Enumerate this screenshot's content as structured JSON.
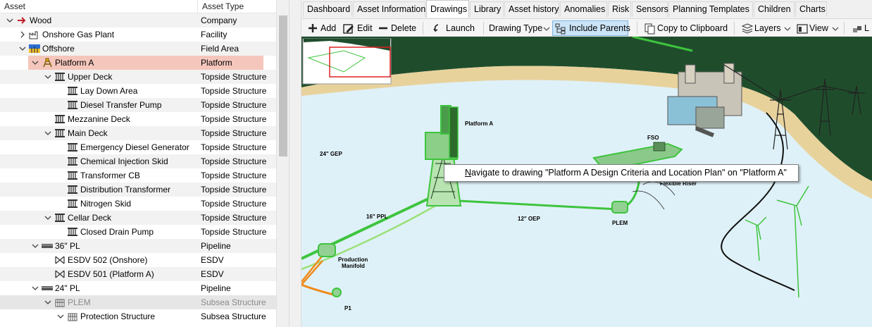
{
  "tree": {
    "col_asset": "Asset",
    "col_type": "Asset Type",
    "rows": [
      {
        "label": "Wood",
        "type": "Company",
        "indent": 0,
        "exp": "v",
        "icon": "arrow"
      },
      {
        "label": "Onshore Gas Plant",
        "type": "Facility",
        "indent": 1,
        "exp": ">",
        "icon": "plant"
      },
      {
        "label": "Offshore",
        "type": "Field Area",
        "indent": 1,
        "exp": "v",
        "icon": "field"
      },
      {
        "label": "Platform A",
        "type": "Platform",
        "indent": 2,
        "exp": "v",
        "icon": "platform"
      },
      {
        "label": "Upper Deck",
        "type": "Topside Structure",
        "indent": 3,
        "exp": "v",
        "icon": "struct"
      },
      {
        "label": "Lay Down Area",
        "type": "Topside Structure",
        "indent": 4,
        "exp": "",
        "icon": "struct"
      },
      {
        "label": "Diesel Transfer Pump",
        "type": "Topside Structure",
        "indent": 4,
        "exp": "",
        "icon": "struct"
      },
      {
        "label": "Mezzanine Deck",
        "type": "Topside Structure",
        "indent": 3,
        "exp": "",
        "icon": "struct"
      },
      {
        "label": "Main Deck",
        "type": "Topside Structure",
        "indent": 3,
        "exp": "v",
        "icon": "struct"
      },
      {
        "label": "Emergency Diesel Generator",
        "type": "Topside Structure",
        "indent": 4,
        "exp": "",
        "icon": "struct"
      },
      {
        "label": "Chemical Injection Skid",
        "type": "Topside Structure",
        "indent": 4,
        "exp": "",
        "icon": "struct"
      },
      {
        "label": "Transformer CB",
        "type": "Topside Structure",
        "indent": 4,
        "exp": "",
        "icon": "struct"
      },
      {
        "label": "Distribution Transformer",
        "type": "Topside Structure",
        "indent": 4,
        "exp": "",
        "icon": "struct"
      },
      {
        "label": "Nitrogen Skid",
        "type": "Topside Structure",
        "indent": 4,
        "exp": "",
        "icon": "struct"
      },
      {
        "label": "Cellar Deck",
        "type": "Topside Structure",
        "indent": 3,
        "exp": "v",
        "icon": "struct"
      },
      {
        "label": "Closed Drain Pump",
        "type": "Topside Structure",
        "indent": 4,
        "exp": "",
        "icon": "struct"
      },
      {
        "label": "36\" PL",
        "type": "Pipeline",
        "indent": 2,
        "exp": "v",
        "icon": "pipe"
      },
      {
        "label": "ESDV 502 (Onshore)",
        "type": "ESDV",
        "indent": 3,
        "exp": "",
        "icon": "valve"
      },
      {
        "label": "ESDV 501 (Platform A)",
        "type": "ESDV",
        "indent": 3,
        "exp": "",
        "icon": "valve"
      },
      {
        "label": "24\" PL",
        "type": "Pipeline",
        "indent": 2,
        "exp": "v",
        "icon": "pipe"
      },
      {
        "label": "PLEM",
        "type": "Subsea Structure",
        "indent": 3,
        "exp": "v",
        "icon": "subsea"
      },
      {
        "label": "Protection Structure",
        "type": "Subsea Structure",
        "indent": 4,
        "exp": "v",
        "icon": "subsea"
      }
    ]
  },
  "tabs": [
    "Dashboard",
    "Asset Information",
    "Drawings",
    "Library",
    "Asset history",
    "Anomalies",
    "Risk",
    "Sensors",
    "Planning Templates",
    "Children",
    "Charts"
  ],
  "active_tab": "Drawings",
  "toolbar": {
    "add": "Add",
    "edit": "Edit",
    "delete": "Delete",
    "launch": "Launch",
    "drawing_type": "Drawing Type",
    "include_parents": "Include Parents",
    "copy": "Copy to Clipboard",
    "layers": "Layers",
    "view": "View",
    "overflow": "L"
  },
  "drawing": {
    "labels": {
      "platform_a": "Platform A",
      "fso": "FSO",
      "gep": "24\" GEP",
      "flexible_riser": "Flexible Riser",
      "ppl": "16\" PPL",
      "oep": "12\" OEP",
      "plem": "PLEM",
      "manifold_1": "Production",
      "manifold_2": "Manifold",
      "p1": "P1"
    },
    "colors": {
      "sea": "#dff1f8",
      "land": "#1f4d2c",
      "beach": "#e8d29c",
      "highlight": "#3ec43e",
      "orange_pipe": "#f08a1a"
    }
  },
  "tooltip": {
    "key": "N",
    "text": "avigate to drawing \"Platform A Design Criteria and Location Plan\" on \"Platform A\""
  }
}
